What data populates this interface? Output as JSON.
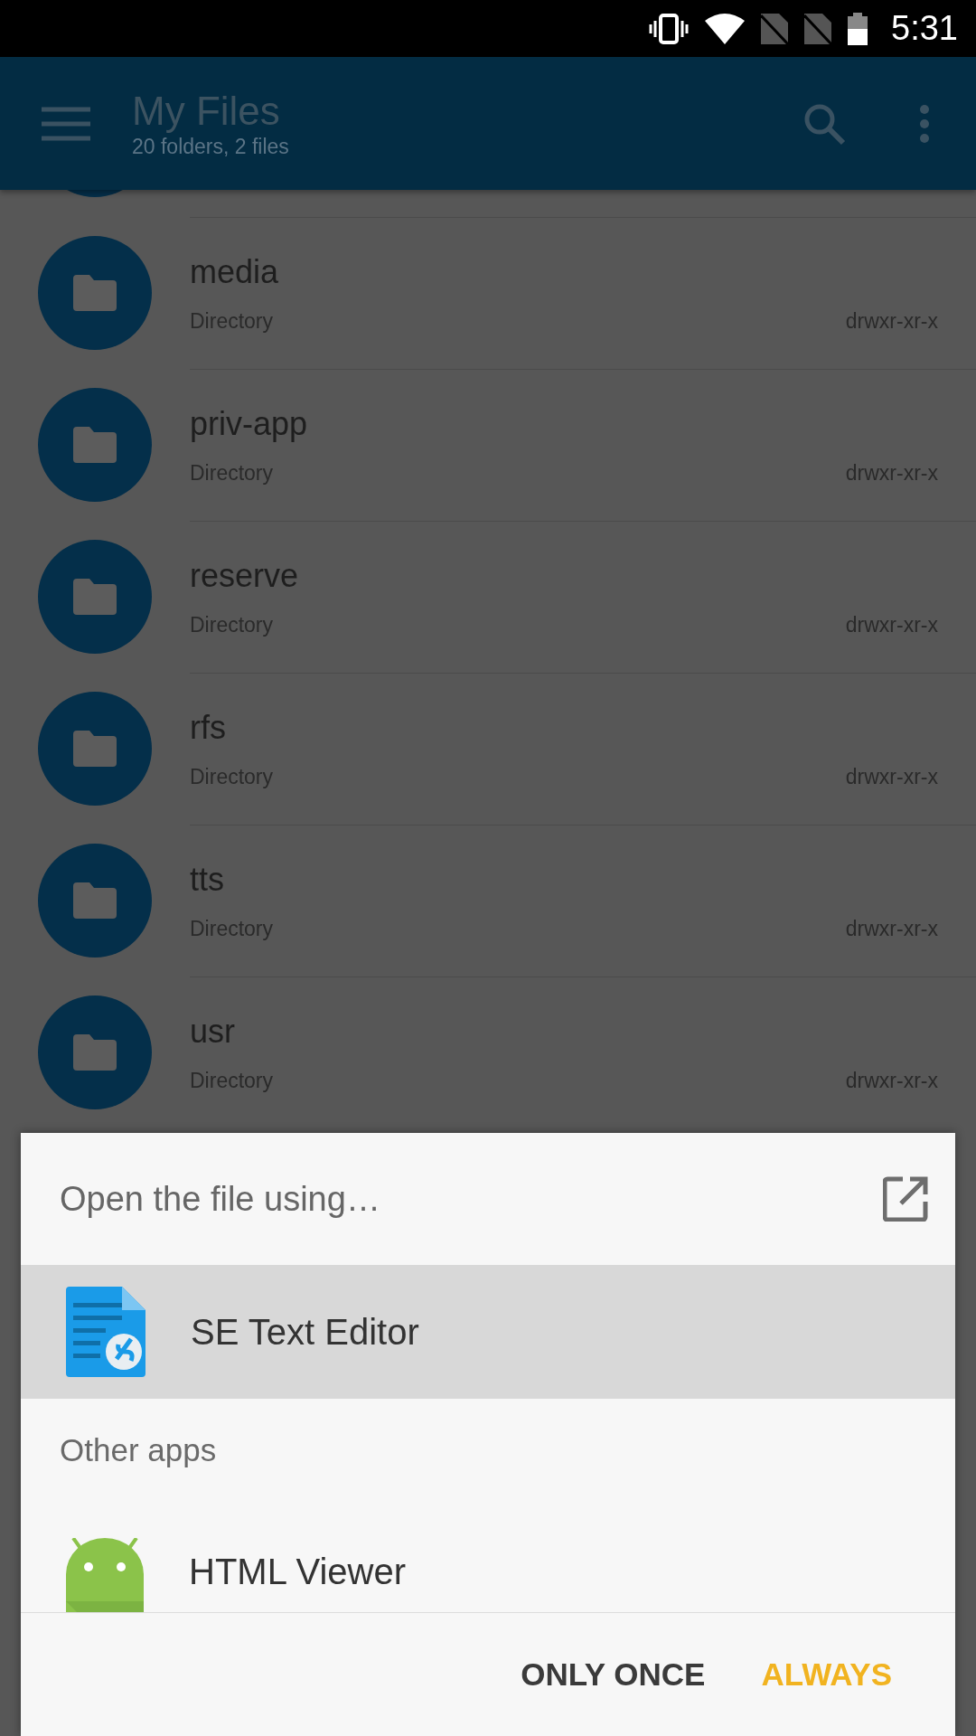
{
  "status_bar": {
    "time": "5:31"
  },
  "app_bar": {
    "title": "My Files",
    "subtitle": "20 folders, 2 files"
  },
  "files": [
    {
      "name": "media",
      "type": "Directory",
      "permissions": "drwxr-xr-x"
    },
    {
      "name": "priv-app",
      "type": "Directory",
      "permissions": "drwxr-xr-x"
    },
    {
      "name": "reserve",
      "type": "Directory",
      "permissions": "drwxr-xr-x"
    },
    {
      "name": "rfs",
      "type": "Directory",
      "permissions": "drwxr-xr-x"
    },
    {
      "name": "tts",
      "type": "Directory",
      "permissions": "drwxr-xr-x"
    },
    {
      "name": "usr",
      "type": "Directory",
      "permissions": "drwxr-xr-x"
    }
  ],
  "dialog": {
    "title": "Open the file using…",
    "apps": [
      {
        "name": "SE Text Editor",
        "selected": true,
        "kind": "text-editor"
      }
    ],
    "section_label": "Other apps",
    "other_apps": [
      {
        "name": "HTML Viewer",
        "selected": false,
        "kind": "android"
      }
    ],
    "buttons": [
      {
        "label": "ONLY ONCE",
        "kind": "neutral"
      },
      {
        "label": "ALWAYS",
        "kind": "primary"
      }
    ]
  }
}
